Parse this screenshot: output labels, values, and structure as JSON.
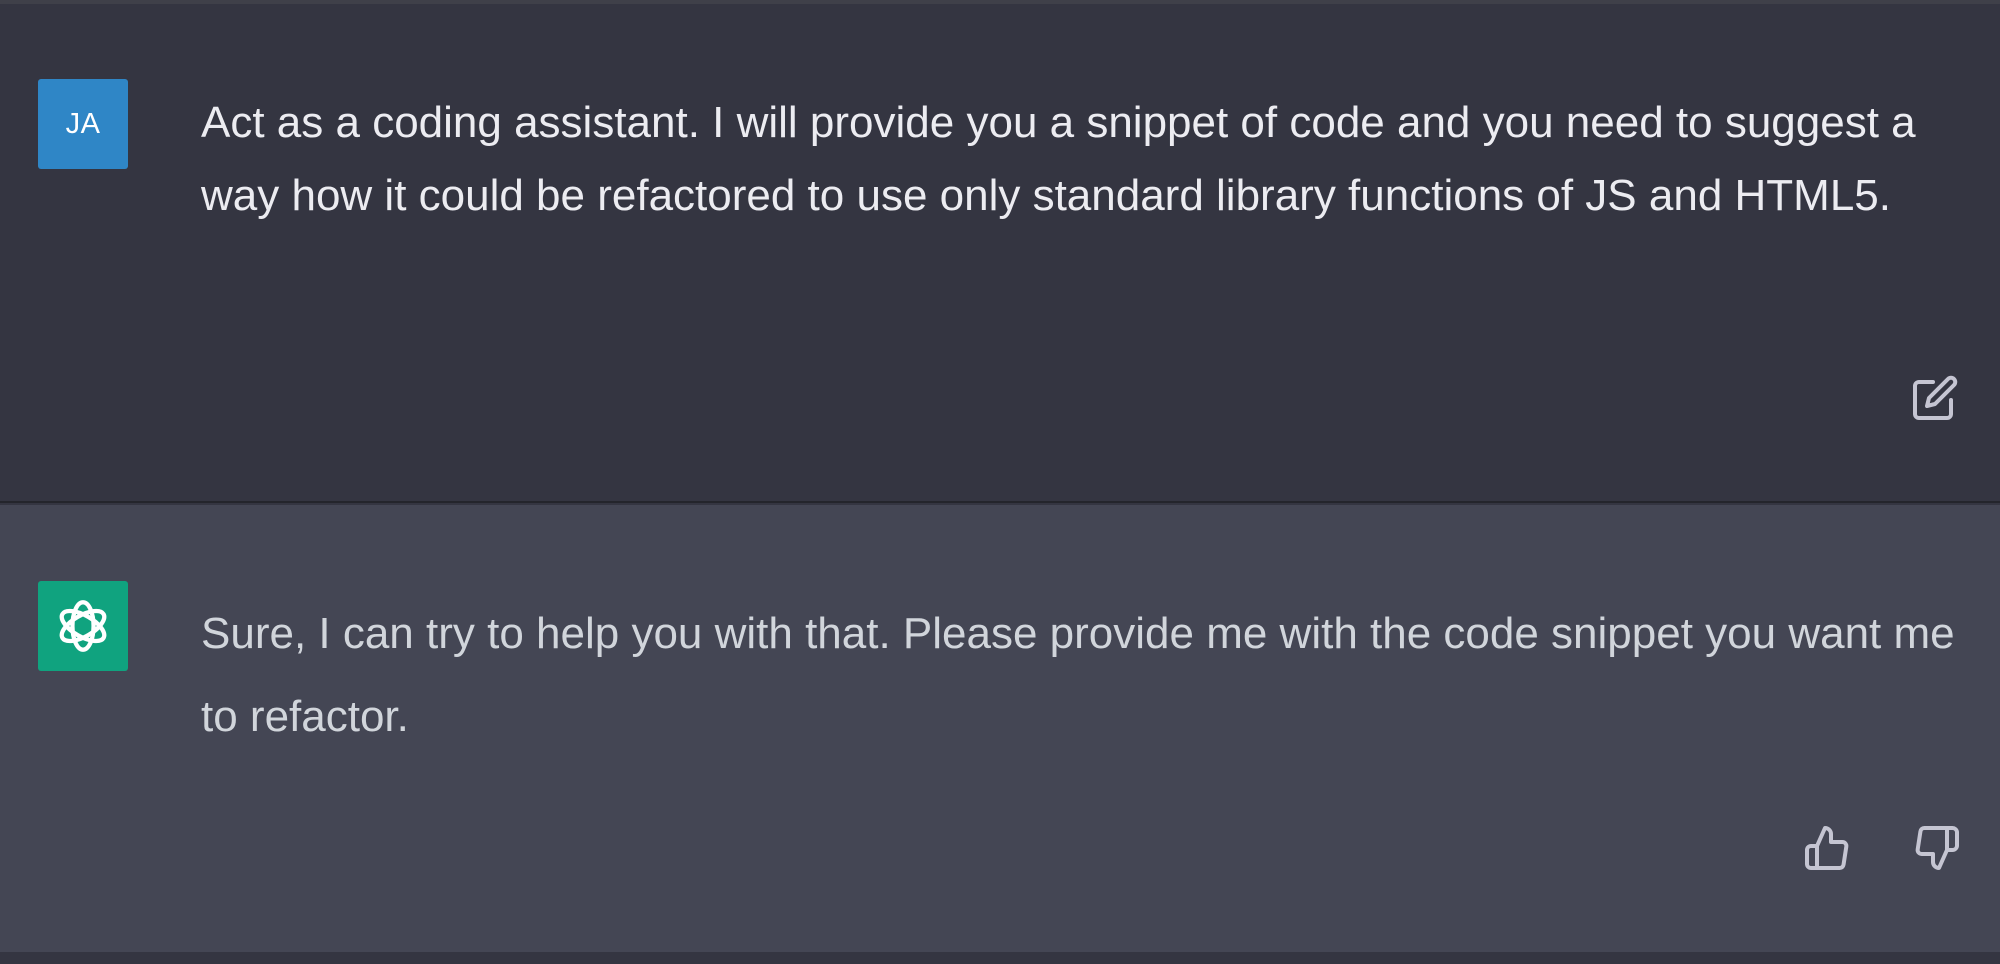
{
  "colors": {
    "user_turn_bg": "#343541",
    "assistant_turn_bg": "#444654",
    "user_avatar_bg": "#2f86c6",
    "assistant_avatar_bg": "#10a37f",
    "user_text": "#ececf1",
    "assistant_text": "#d1d5db",
    "icon_stroke": "#c5c5d2"
  },
  "user_turn": {
    "avatar_initials": "JA",
    "message": "Act as a coding assistant. I will provide you a snippet of code and you need to suggest a way how it could be refactored to use only standard library functions of JS and HTML5.",
    "actions": [
      {
        "icon": "edit-icon"
      }
    ]
  },
  "assistant_turn": {
    "avatar_icon": "openai-logo-icon",
    "message": "Sure, I can try to help you with that. Please provide me with the code snippet you want me to refactor.",
    "actions": [
      {
        "icon": "thumbs-up-icon"
      },
      {
        "icon": "thumbs-down-icon"
      }
    ]
  }
}
